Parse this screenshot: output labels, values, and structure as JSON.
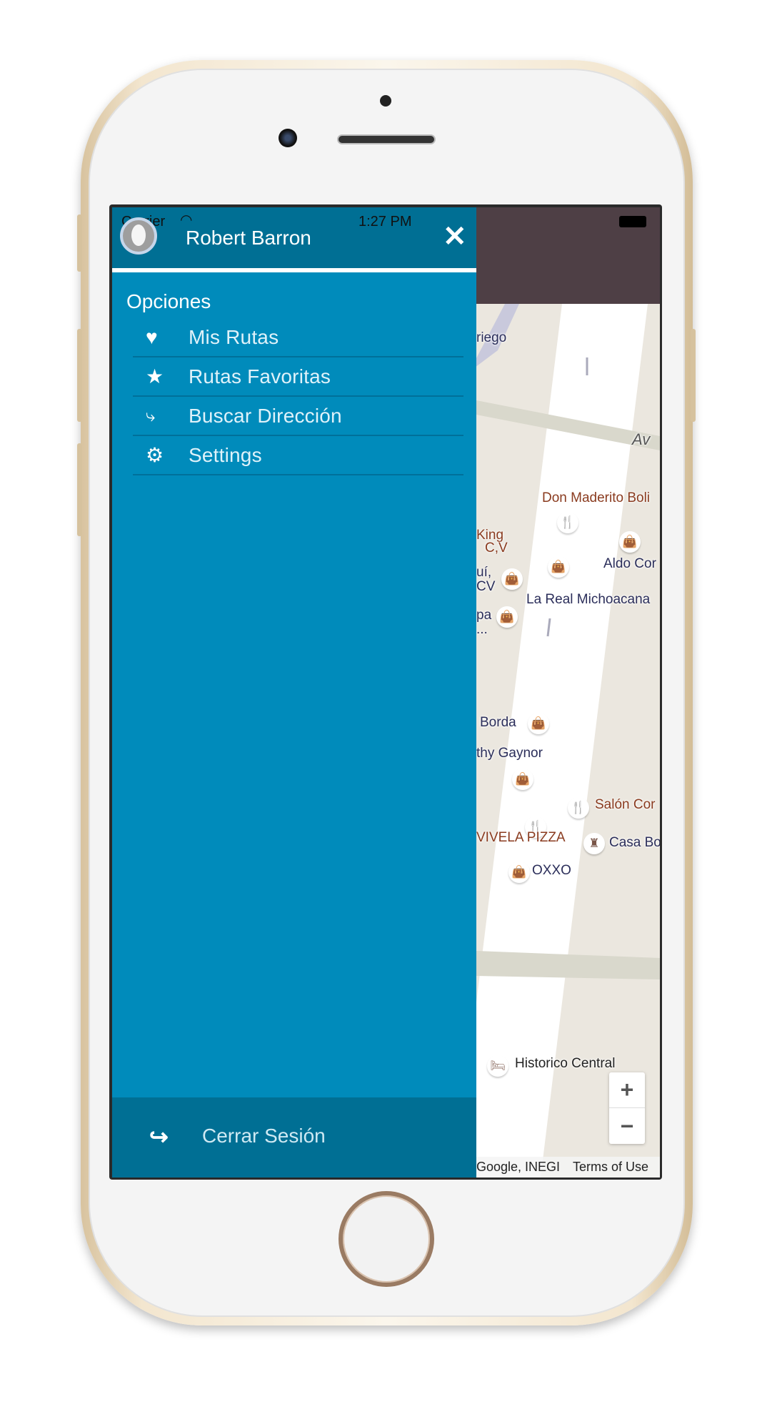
{
  "status_bar": {
    "carrier": "Carrier",
    "time": "1:27 PM"
  },
  "drawer": {
    "user_name": "Robert Barron",
    "section_title": "Opciones",
    "items": [
      {
        "label": "Mis Rutas",
        "icon": "heart-icon"
      },
      {
        "label": "Rutas Favoritas",
        "icon": "star-icon"
      },
      {
        "label": "Buscar Dirección",
        "icon": "route-pin-icon"
      },
      {
        "label": "Settings",
        "icon": "gear-icon"
      }
    ],
    "logout_label": "Cerrar Sesión"
  },
  "map": {
    "labels": {
      "riego": "riego",
      "av": "Av",
      "don_maderito": "Don Maderito Boli",
      "king": "King",
      "cv1": "C,V",
      "aldo": "Aldo Cor",
      "qui": "uí,",
      "cv2": "CV",
      "la_real": "La Real Michoacana",
      "pa": "pa",
      "dots": "...",
      "borda": "Borda",
      "gaynor": "thy Gaynor",
      "salon": "Salón Cor",
      "vivela": "VIVELA PIZZA",
      "casa": "Casa Bo",
      "oxxo": "OXXO",
      "historico": "Historico Central"
    },
    "zoom_in": "+",
    "zoom_out": "−",
    "attribution": "Google, INEGI",
    "terms": "Terms of Use"
  },
  "colors": {
    "drawer": "#008bbb",
    "drawer_header": "#006f94",
    "navbar": "#4e3f45",
    "restaurant": "#f57c00",
    "shop": "#5c6bc0"
  }
}
